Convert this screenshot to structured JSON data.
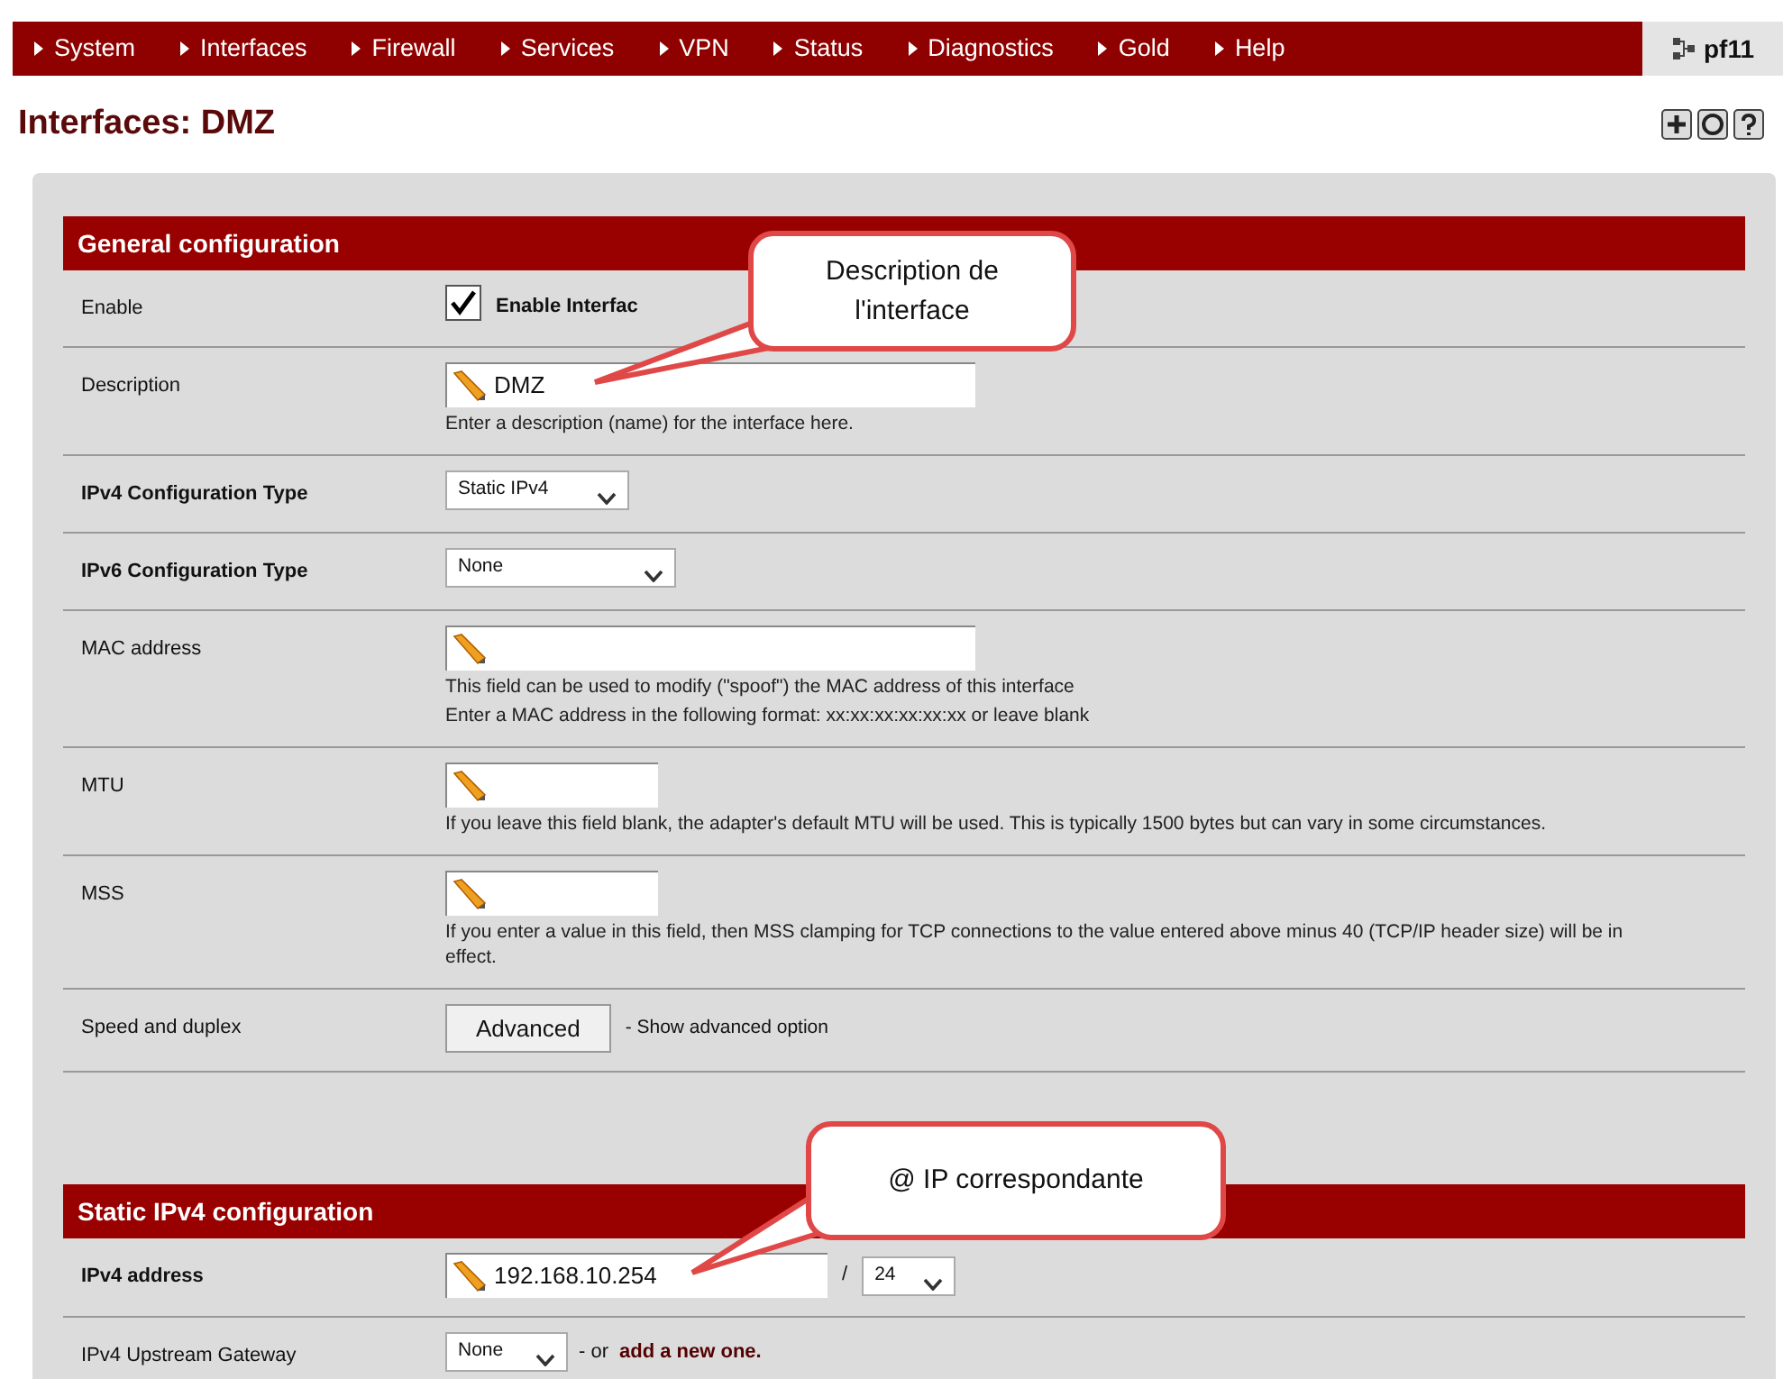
{
  "nav": {
    "items": [
      {
        "label": "System"
      },
      {
        "label": "Interfaces"
      },
      {
        "label": "Firewall"
      },
      {
        "label": "Services"
      },
      {
        "label": "VPN"
      },
      {
        "label": "Status"
      },
      {
        "label": "Diagnostics"
      },
      {
        "label": "Gold"
      },
      {
        "label": "Help"
      }
    ],
    "brand": "pf11"
  },
  "page_title": "Interfaces: DMZ",
  "sections": [
    {
      "title": "General configuration",
      "rows": [
        {
          "label": "Enable",
          "bold": false,
          "kind": "checkbox",
          "checked": true,
          "text": "Enable Interfac"
        },
        {
          "label": "Description",
          "bold": false,
          "kind": "text",
          "value": "DMZ",
          "hints": [
            "Enter a description (name) for the interface here."
          ]
        },
        {
          "label": "IPv4 Configuration Type",
          "bold": true,
          "kind": "select",
          "value": "Static IPv4"
        },
        {
          "label": "IPv6 Configuration Type",
          "bold": true,
          "kind": "wide_select",
          "value": "None"
        },
        {
          "label": "MAC address",
          "bold": false,
          "kind": "text",
          "value": "",
          "hints": [
            "This field can be used to modify (\"spoof\") the MAC address of this interface",
            "Enter a MAC address in the following format: xx:xx:xx:xx:xx:xx or leave blank"
          ]
        },
        {
          "label": "MTU",
          "bold": false,
          "kind": "short_text",
          "value": "",
          "hints": [
            "If you leave this field blank, the adapter's default MTU will be used. This is typically 1500 bytes but can vary in some circumstances."
          ]
        },
        {
          "label": "MSS",
          "bold": false,
          "kind": "short_text",
          "value": "",
          "hints": [
            "If you enter a value in this field, then MSS clamping for TCP connections to the value entered above minus 40 (TCP/IP header size) will be in effect."
          ]
        },
        {
          "label": "Speed and duplex",
          "bold": false,
          "kind": "button",
          "button": "Advanced",
          "note": "- Show advanced option"
        }
      ]
    },
    {
      "title": "Static IPv4 configuration",
      "rows": [
        {
          "label": "IPv4 address",
          "bold": true,
          "kind": "address",
          "value": "192.168.10.254",
          "separator": "/",
          "mask": "24"
        },
        {
          "label": "IPv4 Upstream Gateway",
          "bold": false,
          "kind": "select_link",
          "value": "None",
          "text": "- or",
          "link": "add a new one."
        }
      ]
    }
  ],
  "callouts": [
    {
      "lines": [
        "Description de",
        "l'interface"
      ]
    },
    {
      "lines": [
        "@ IP correspondante"
      ]
    }
  ]
}
